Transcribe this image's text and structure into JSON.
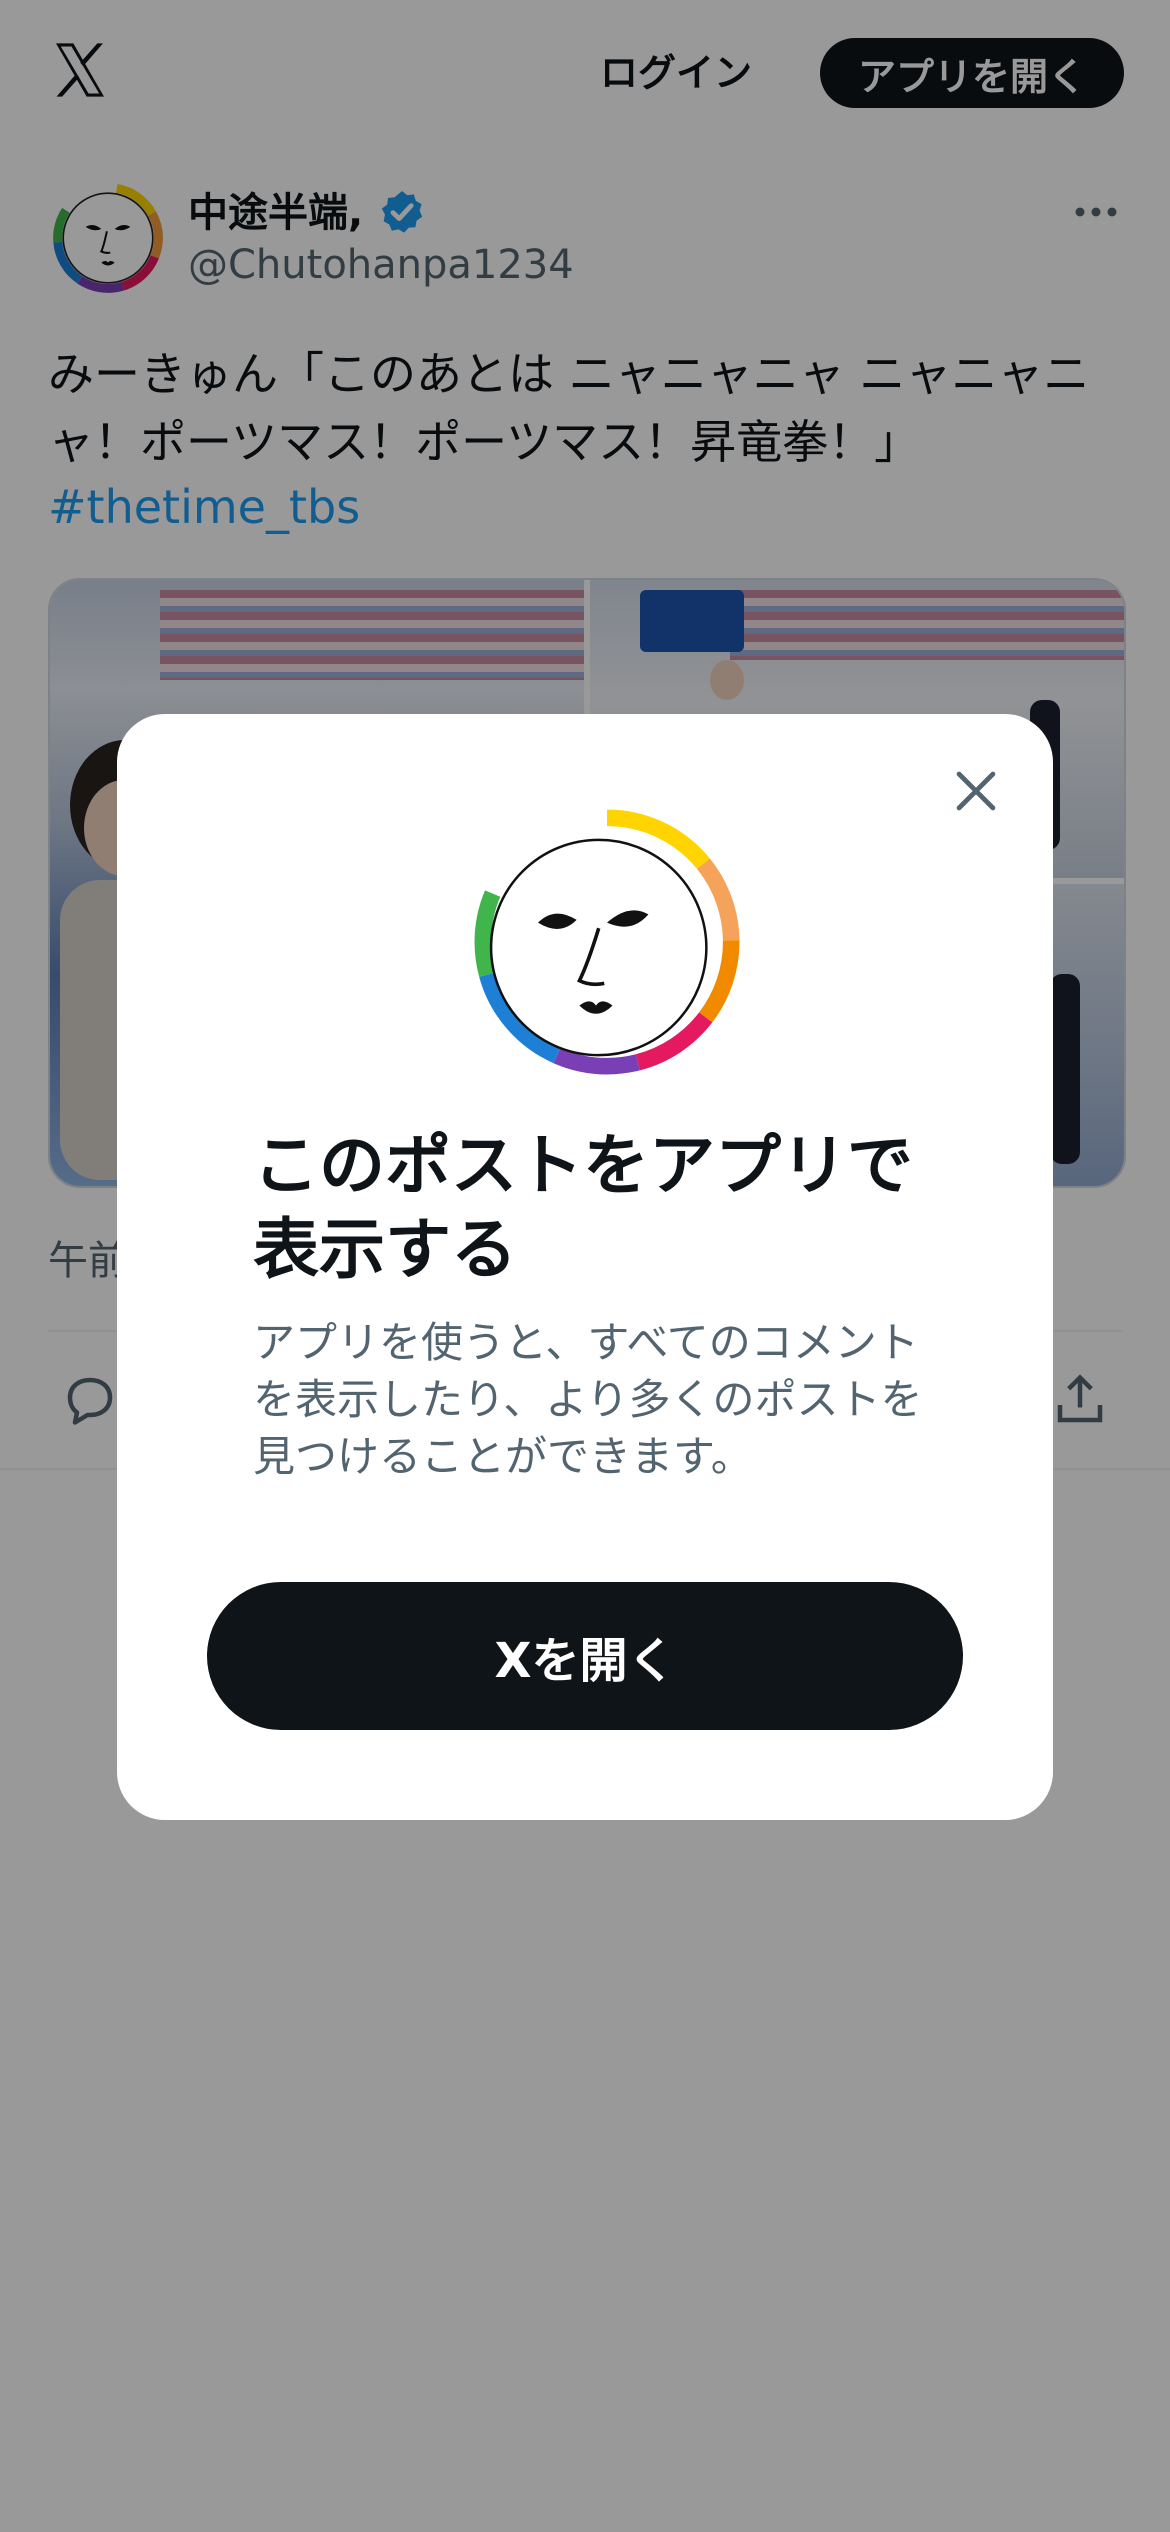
{
  "header": {
    "logo_icon": "x-logo-icon",
    "login_label": "ログイン",
    "open_app_label": "アプリを開く"
  },
  "post": {
    "author_name": "中途半端,",
    "author_handle": "@Chutohanpa1234",
    "text": "みーきゅん「このあとは ニャニャニャ ニャニャニャ！ポーツマス！ポーツマス！昇竜拳！」",
    "hashtag": "#thetime_tbs",
    "timestamp": "午前",
    "actions": [
      "reply-icon",
      "share-icon"
    ]
  },
  "modal": {
    "title": "このポストをアプリで表示する",
    "description": "アプリを使うと、すべてのコメントを表示したり、より多くのポストを見つけることができます。",
    "button_label": "Xを開く",
    "close_icon": "close-icon"
  },
  "colors": {
    "primary_text": "#0f1419",
    "secondary_text": "#536471",
    "link": "#1d9bf0",
    "button_bg": "#0f1419",
    "overlay": "rgba(0,0,0,0.40)"
  }
}
